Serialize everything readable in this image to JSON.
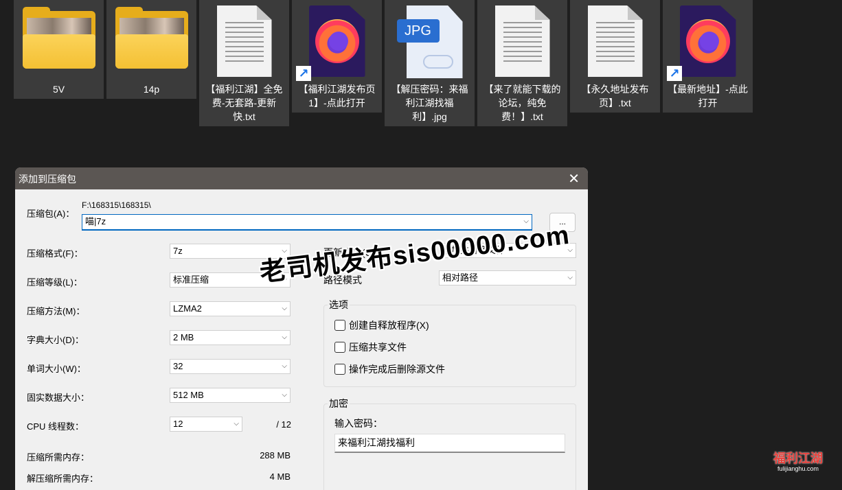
{
  "desktop": {
    "icons": [
      {
        "label": "5V",
        "type": "folder"
      },
      {
        "label": "14p",
        "type": "folder"
      },
      {
        "label": "【福利江湖】全免费-无套路-更新快.txt",
        "type": "text"
      },
      {
        "label": "【福利江湖发布页1】-点此打开",
        "type": "firefox-shortcut"
      },
      {
        "label": "【解压密码：来福利江湖找福利】.jpg",
        "type": "jpg",
        "badge": "JPG"
      },
      {
        "label": "【来了就能下载的论坛，纯免费！】.txt",
        "type": "text"
      },
      {
        "label": "【永久地址发布页】.txt",
        "type": "text"
      },
      {
        "label": "【最新地址】-点此打开",
        "type": "firefox-shortcut"
      }
    ]
  },
  "dialog": {
    "title": "添加到压缩包",
    "close_icon": "close-icon",
    "archive_label": "压缩包(A)：",
    "archive_path": "F:\\168315\\168315\\",
    "archive_name": "喵|7z",
    "browse_label": "...",
    "fields": [
      {
        "label": "压缩格式(F)：",
        "value": "7z"
      },
      {
        "label": "压缩等级(L)：",
        "value": "标准压缩"
      },
      {
        "label": "压缩方法(M)：",
        "value": "LZMA2"
      },
      {
        "label": "字典大小(D)：",
        "value": "2 MB"
      },
      {
        "label": "单词大小(W)：",
        "value": "32"
      },
      {
        "label": "固实数据大小：",
        "value": "512 MB"
      }
    ],
    "cpu": {
      "label": "CPU 线程数：",
      "value": "12",
      "max": "/ 12"
    },
    "memory": [
      {
        "label": "压缩所需内存：",
        "value": "288 MB"
      },
      {
        "label": "解压缩所需内存：",
        "value": "4 MB"
      }
    ],
    "update_mode": {
      "label": "更新方式(U)：",
      "value": "添加并替换文件"
    },
    "path_mode": {
      "label": "路径模式",
      "value": "相对路径"
    },
    "options": {
      "title": "选项",
      "items": [
        "创建自释放程序(X)",
        "压缩共享文件",
        "操作完成后删除源文件"
      ]
    },
    "encryption": {
      "title": "加密",
      "password_label": "输入密码：",
      "password_value": "来福利江湖找福利"
    }
  },
  "watermark": "老司机发布sis00000.com",
  "logo": {
    "text": "福利江湖",
    "domain": "fulijianghu.com",
    "color": "#e8423d"
  }
}
